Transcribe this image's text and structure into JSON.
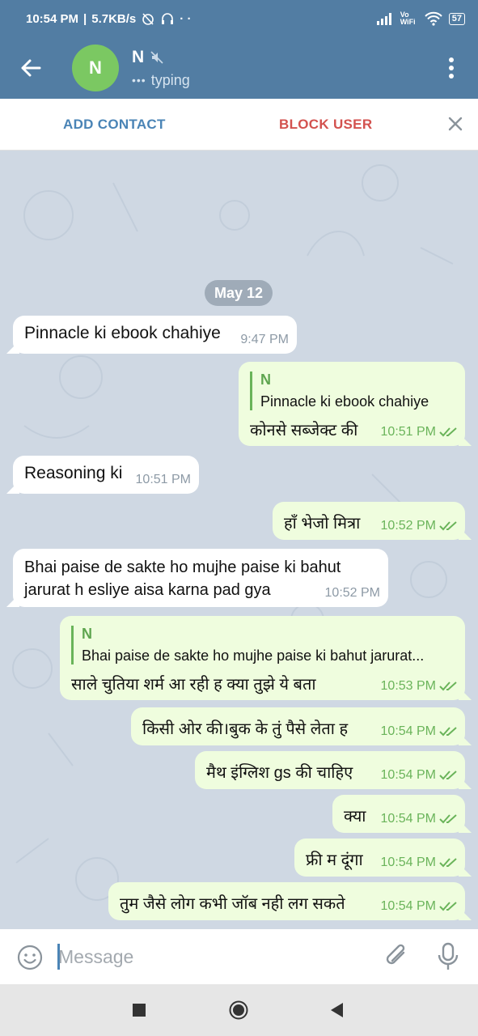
{
  "status_bar": {
    "time": "10:54 PM",
    "speed": "5.7KB/s",
    "network_label": "Vo WiFi",
    "battery": "57"
  },
  "header": {
    "avatar_letter": "N",
    "name": "N",
    "status": "typing",
    "avatar_color": "#7bc862",
    "bar_color": "#527da3"
  },
  "actions": {
    "add_contact": "ADD CONTACT",
    "block_user": "BLOCK USER"
  },
  "chat": {
    "date": "May 12",
    "messages": [
      {
        "dir": "in",
        "text": "Pinnacle ki ebook chahiye",
        "time": "9:47 PM"
      },
      {
        "dir": "out",
        "reply_name": "N",
        "reply_text": "Pinnacle ki ebook chahiye",
        "text": "कोनसे सब्जेक्ट की",
        "time": "10:51 PM"
      },
      {
        "dir": "in",
        "text": "Reasoning ki",
        "time": "10:51 PM"
      },
      {
        "dir": "out",
        "text": "हाँ भेजो मित्रा",
        "time": "10:52 PM"
      },
      {
        "dir": "in",
        "text_line1": "Bhai paise de sakte ho mujhe paise ki bahut",
        "text_line2": "jarurat h esliye aisa karna pad gya",
        "time": "10:52 PM"
      },
      {
        "dir": "out",
        "reply_name": "N",
        "reply_text": "Bhai paise de sakte ho mujhe paise ki bahut jarurat...",
        "text": "साले चुतिया शर्म आ रही ह क्या तुझे ये बता",
        "time": "10:53 PM"
      },
      {
        "dir": "out",
        "text": "किसी ओर की।बुक के तुं पैसे लेता ह",
        "time": "10:54 PM"
      },
      {
        "dir": "out",
        "text": "मैथ इंग्लिश gs की चाहिए",
        "time": "10:54 PM"
      },
      {
        "dir": "out",
        "text": "क्या",
        "time": "10:54 PM"
      },
      {
        "dir": "out",
        "text": "फ्री म दूंगा",
        "time": "10:54 PM"
      },
      {
        "dir": "out",
        "text": "तुम जैसे लोग कभी जॉब नही लग सकते",
        "time": "10:54 PM"
      }
    ]
  },
  "input": {
    "placeholder": "Message"
  },
  "icons": {
    "back": "arrow-left-icon",
    "mute": "mute-icon",
    "menu": "more-vertical-icon",
    "close": "close-icon",
    "emoji": "emoji-icon",
    "attach": "paperclip-icon",
    "mic": "microphone-icon",
    "read": "double-check-icon"
  },
  "colors": {
    "incoming": "#ffffff",
    "outgoing": "#effdde",
    "accent": "#4a84b6",
    "danger": "#d3524f",
    "check": "#6ab45a"
  }
}
